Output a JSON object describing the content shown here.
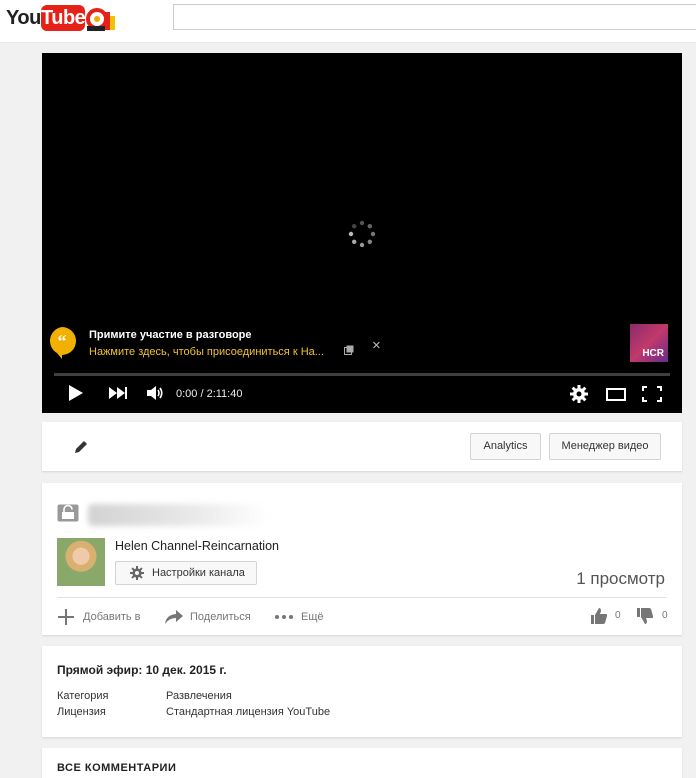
{
  "masthead": {
    "logo_you": "You",
    "logo_tube": "Tube",
    "search_value": ""
  },
  "player": {
    "conversation_title": "Примите участие в разговоре",
    "conversation_subtitle": "Нажмите здесь, чтобы присоединиться к Ha...",
    "close_glyph": "×",
    "badge_text": "HCR",
    "time_display": "0:00 / 2:11:40",
    "progress_fraction": 0
  },
  "edit_bar": {
    "analytics_label": "Analytics",
    "manager_label": "Менеджер видео"
  },
  "video_info": {
    "channel_name": "Helen Channel-Reincarnation",
    "channel_settings_label": "Настройки канала",
    "view_count": "1 просмотр",
    "add_to_label": "Добавить в",
    "share_label": "Поделиться",
    "more_label": "Ещё",
    "likes": "0",
    "dislikes": "0"
  },
  "description": {
    "published": "Прямой эфир: 10 дек. 2015 г.",
    "category_label": "Категория",
    "category_value": "Развлечения",
    "license_label": "Лицензия",
    "license_value": "Стандартная лицензия YouTube"
  },
  "comments": {
    "title": "ВСЕ КОММЕНТАРИИ"
  },
  "colors": {
    "brand_red": "#e62117",
    "background": "#f1f1f1",
    "player_bg": "#000000",
    "conversation_accent": "#f1c232"
  }
}
